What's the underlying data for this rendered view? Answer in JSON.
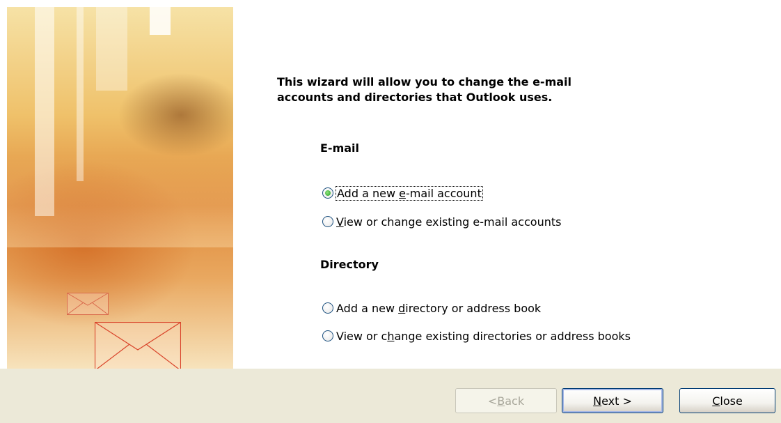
{
  "intro": {
    "line1": "This wizard will allow you to change the e-mail",
    "line2": "accounts and directories that Outlook uses."
  },
  "email_section": {
    "heading": "E-mail",
    "options": [
      {
        "pre": "Add a new ",
        "accel": "e",
        "post": "-mail account",
        "selected": true
      },
      {
        "pre": "",
        "accel": "V",
        "post": "iew or change existing e-mail accounts",
        "selected": false
      }
    ]
  },
  "directory_section": {
    "heading": "Directory",
    "options": [
      {
        "pre": "Add a new ",
        "accel": "d",
        "post": "irectory or address book",
        "selected": false
      },
      {
        "pre": "View or c",
        "accel": "h",
        "post": "ange existing directories or address books",
        "selected": false
      }
    ]
  },
  "buttons": {
    "back": {
      "pre": "< ",
      "accel": "B",
      "post": "ack",
      "enabled": false
    },
    "next": {
      "pre": "",
      "accel": "N",
      "post": "ext >",
      "enabled": true
    },
    "close": {
      "pre": "",
      "accel": "C",
      "post": "lose",
      "enabled": true
    }
  },
  "colors": {
    "bottom_bar": "#ece9d8",
    "radio_selected": "#21a121",
    "button_border": "#003c74"
  }
}
